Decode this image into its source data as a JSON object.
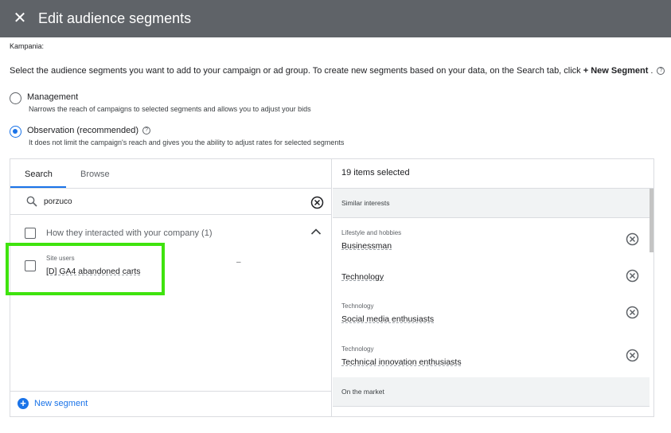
{
  "header": {
    "title": "Edit audience segments",
    "close_icon": "close-icon"
  },
  "campaign_label": "Kampania:",
  "intro": {
    "text": "Select the audience segments you want to add to your campaign or ad group. To create new segments based on your data, on the Search tab, click ",
    "bold": "+ New Segment",
    "after": " ."
  },
  "targeting": {
    "management": {
      "label": "Management",
      "desc": "Narrows the reach of campaigns to selected segments and allows you to adjust your bids",
      "selected": false
    },
    "observation": {
      "label": "Observation (recommended)",
      "desc": "It does not limit the campaign's reach and gives you the ability to adjust rates for selected segments",
      "selected": true
    }
  },
  "left_panel": {
    "tabs": [
      {
        "label": "Search",
        "active": true
      },
      {
        "label": "Browse",
        "active": false
      }
    ],
    "search": {
      "query": "porzuco"
    },
    "group": {
      "label": "How they interacted with your company (1)",
      "expanded": true
    },
    "result": {
      "category": "Site users",
      "name": "[D] GA4 abandoned carts",
      "checked": false
    },
    "dash": "–",
    "new_segment_label": "New segment"
  },
  "right_panel": {
    "header": "19 items selected",
    "sections": [
      {
        "title": "Similar interests",
        "items": [
          {
            "category": "Lifestyle and hobbies",
            "name": "Businessman"
          },
          {
            "category": "",
            "name": "Technology"
          },
          {
            "category": "Technology",
            "name": "Social media enthusiasts"
          },
          {
            "category": "Technology",
            "name": "Technical innovation enthusiasts"
          }
        ]
      },
      {
        "title": "On the market",
        "items": []
      }
    ]
  },
  "colors": {
    "header_bg": "#5f6368",
    "accent": "#1a73e8",
    "highlight": "#3fe30e"
  }
}
